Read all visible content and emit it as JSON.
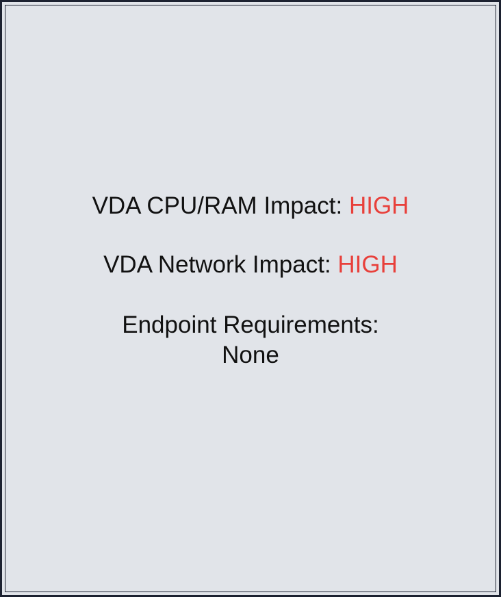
{
  "panel": {
    "cpu": {
      "label": "VDA CPU/RAM Impact: ",
      "value": "HIGH"
    },
    "network": {
      "label": "VDA Network Impact: ",
      "value": "HIGH"
    },
    "endpoint": {
      "label": "Endpoint Requirements:",
      "value": "None"
    }
  },
  "colors": {
    "background": "#e1e4e9",
    "border": "#1c2130",
    "text": "#111111",
    "accent": "#e8403b"
  }
}
